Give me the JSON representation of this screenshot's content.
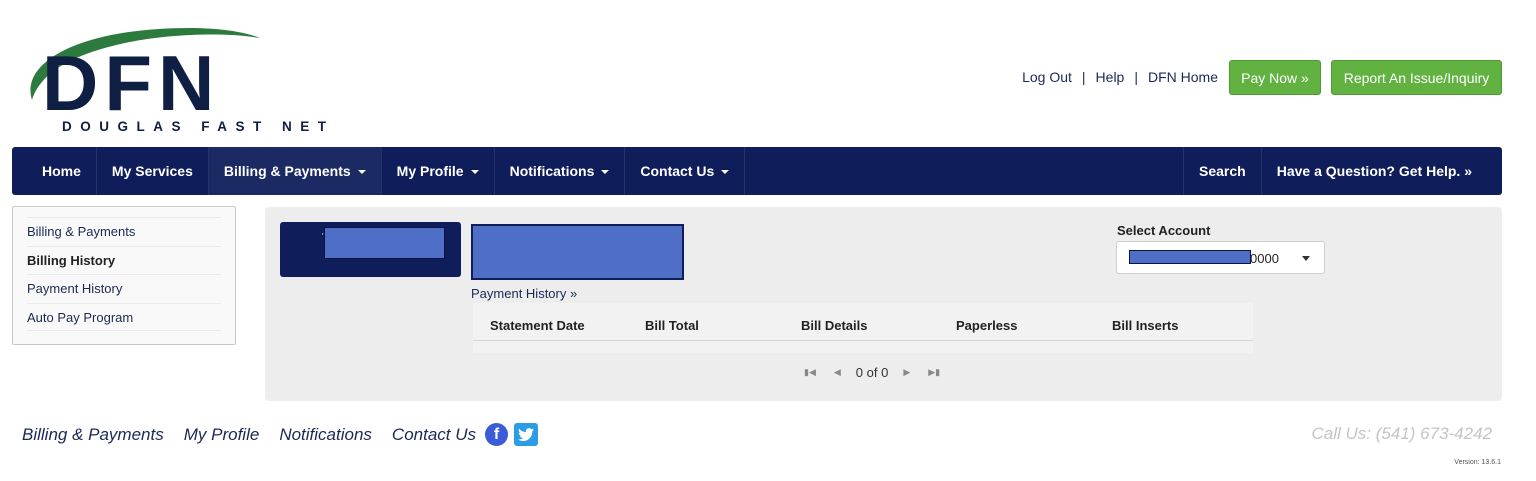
{
  "header": {
    "logo_text": "DFN",
    "logo_subtitle": "DOUGLAS FAST NET",
    "links": [
      "Log Out",
      "Help",
      "DFN Home"
    ],
    "pay_now": "Pay Now »",
    "report_issue": "Report An Issue/Inquiry"
  },
  "nav": {
    "items": [
      {
        "label": "Home",
        "dropdown": false
      },
      {
        "label": "My Services",
        "dropdown": false
      },
      {
        "label": "Billing & Payments",
        "dropdown": true
      },
      {
        "label": "My Profile",
        "dropdown": true
      },
      {
        "label": "Notifications",
        "dropdown": true
      },
      {
        "label": "Contact Us",
        "dropdown": true
      }
    ],
    "search": "Search",
    "help": "Have a Question? Get Help. »"
  },
  "sidebar": {
    "items": [
      "Billing & Payments",
      "Billing History",
      "Payment History",
      "Auto Pay Program"
    ],
    "current": "Billing History"
  },
  "main": {
    "payment_history_link": "Payment History »",
    "select_account_label": "Select Account",
    "select_account_value_suffix": "0000",
    "table_headers": [
      "Statement Date",
      "Bill Total",
      "Bill Details",
      "Paperless",
      "Bill Inserts"
    ],
    "pager_text": "0 of 0"
  },
  "footer": {
    "links": [
      "Billing & Payments",
      "My Profile",
      "Notifications",
      "Contact Us"
    ],
    "call": "Call Us: (541) 673-4242",
    "version": "Version: 13.6.1"
  },
  "colors": {
    "navy": "#0f1e5a",
    "green": "#62b242",
    "logo_green": "#2d7a3e",
    "redact_blue": "#4f6fc7",
    "panel_bg": "#ededed"
  }
}
